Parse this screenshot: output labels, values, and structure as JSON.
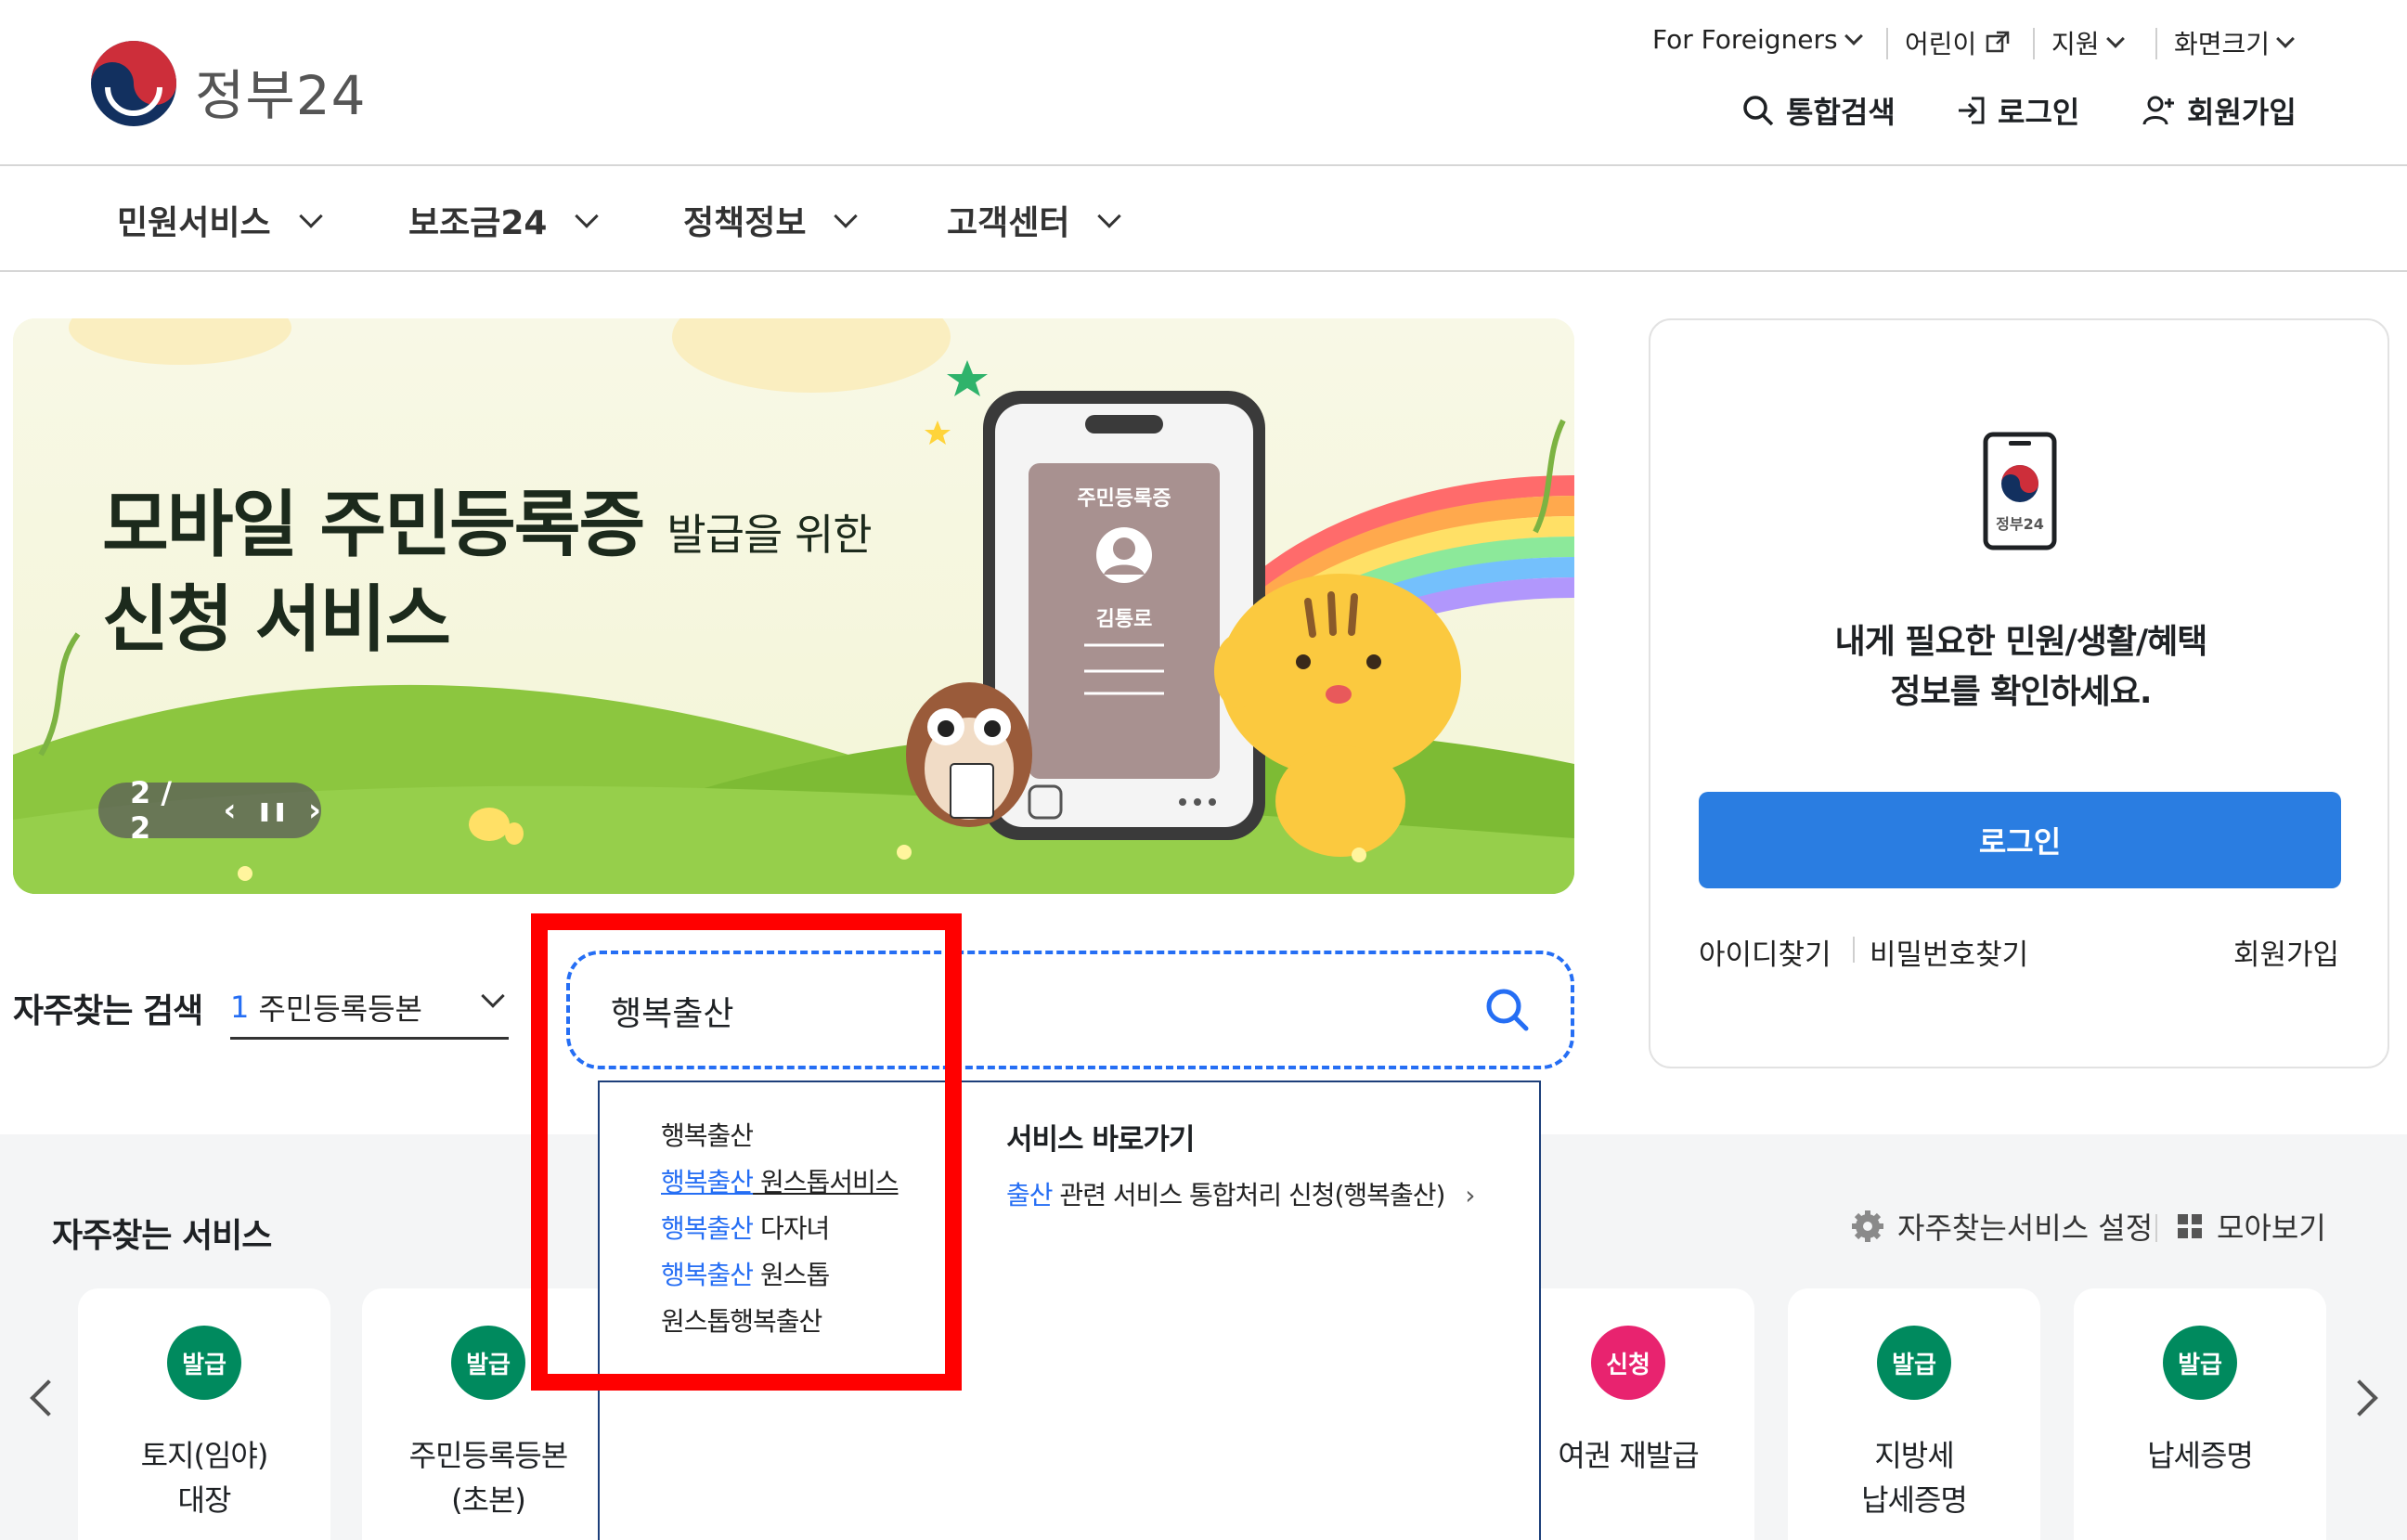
{
  "header": {
    "logo_text": "정부24",
    "util": {
      "foreigners": "For Foreigners",
      "kids": "어린이",
      "support": "지원",
      "screen_size": "화면크기"
    },
    "search_label": "통합검색",
    "login_label": "로그인",
    "signup_label": "회원가입"
  },
  "gnb": {
    "items": [
      {
        "label": "민원서비스"
      },
      {
        "label": "보조금24"
      },
      {
        "label": "정책정보"
      },
      {
        "label": "고객센터"
      }
    ]
  },
  "banner": {
    "title_main": "모바일 주민등록증",
    "title_sub": "발급을 위한",
    "title_line2": "신청 서비스",
    "card_label": "주민등록증",
    "card_name": "김통로",
    "page_indicator": "2 / 2"
  },
  "login_box": {
    "app_icon_label": "정부24",
    "message_line1": "내게 필요한 민원/생활/혜택",
    "message_line2": "정보를 확인하세요.",
    "login_button": "로그인",
    "find_id": "아이디찾기",
    "find_pw": "비밀번호찾기",
    "signup": "회원가입"
  },
  "search": {
    "freq_label": "자주찾는 검색",
    "freq_rank": "1",
    "freq_value": "주민등록등본",
    "query": "행복출산"
  },
  "autocomplete": {
    "items": [
      {
        "hl": "",
        "rest": "행복출산"
      },
      {
        "hl": "행복출산",
        "rest": " 원스톱서비스"
      },
      {
        "hl": "행복출산",
        "rest": " 다자녀"
      },
      {
        "hl": "행복출산",
        "rest": " 원스톱"
      },
      {
        "hl": "",
        "rest": "원스톱행복출산"
      }
    ],
    "shortcut_title": "서비스 바로가기",
    "shortcut_hl": "출산",
    "shortcut_rest": " 관련 서비스 통합처리 신청(행복출산)"
  },
  "services": {
    "title": "자주찾는 서비스",
    "settings_label": "자주찾는서비스 설정",
    "view_all_label": "모아보기",
    "cards": [
      {
        "badge": "발급",
        "name": "토지(임야)\n대장",
        "badge_color": "#008a5e"
      },
      {
        "badge": "발급",
        "name": "주민등록등본\n(초본)",
        "badge_color": "#008a5e"
      },
      {
        "badge": "신청",
        "name": "여권 재발급",
        "badge_color": "#e8236f"
      },
      {
        "badge": "발급",
        "name": "지방세\n납세증명",
        "badge_color": "#008a5e"
      },
      {
        "badge": "발급",
        "name": "납세증명",
        "badge_color": "#008a5e"
      }
    ]
  },
  "colors": {
    "accent": "#256ef4",
    "login_button": "#2a7de1",
    "highlight_box": "#ff0000"
  }
}
